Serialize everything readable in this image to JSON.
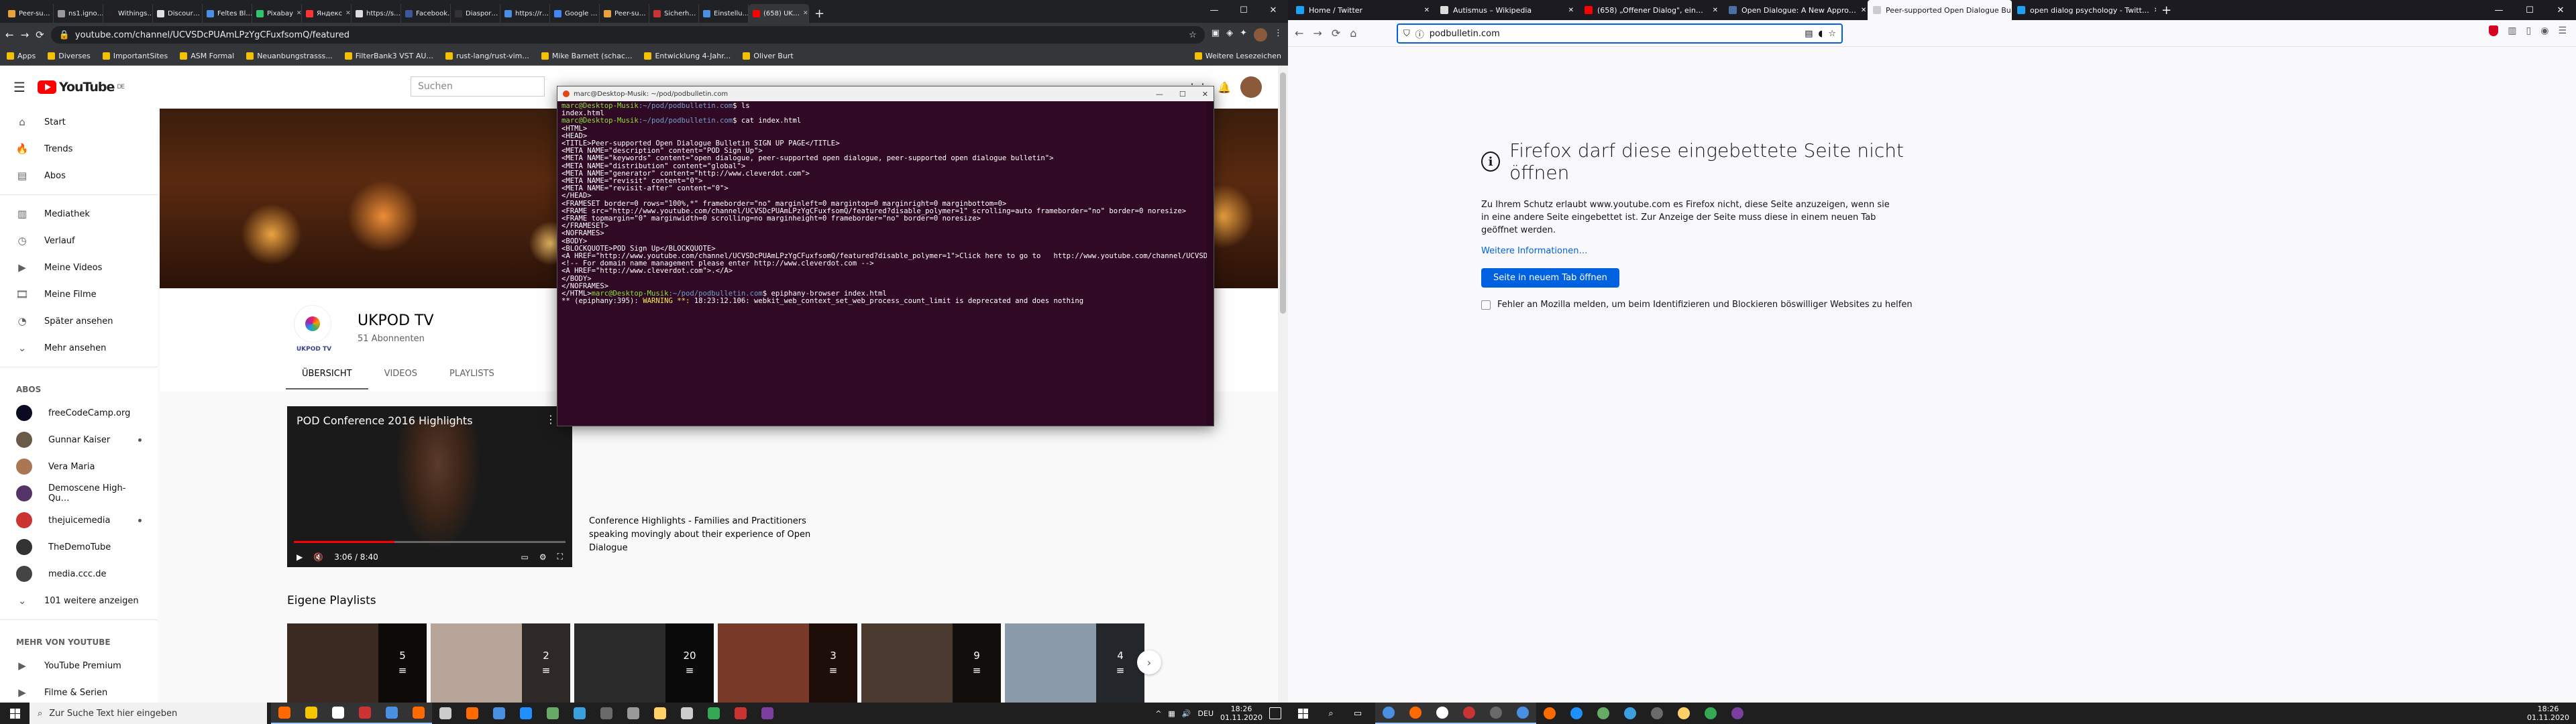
{
  "chrome": {
    "tabs": [
      {
        "label": "Peer-su…",
        "color": "#e9a23b"
      },
      {
        "label": "ns1.igno…",
        "color": "#999999"
      },
      {
        "label": "Withings…",
        "color": "#222222"
      },
      {
        "label": "Discour…",
        "color": "#e0e0e0"
      },
      {
        "label": "Feltes Bl…",
        "color": "#4a90e2"
      },
      {
        "label": "Pixabay",
        "color": "#2ec66d"
      },
      {
        "label": "Яндекс",
        "color": "#ff3333"
      },
      {
        "label": "https://s…",
        "color": "#dddddd"
      },
      {
        "label": "Facebook…",
        "color": "#3b5998"
      },
      {
        "label": "Diaspor…",
        "color": "#333333"
      },
      {
        "label": "https://r…",
        "color": "#4a90e2"
      },
      {
        "label": "Google …",
        "color": "#4285f4"
      },
      {
        "label": "Peer-su…",
        "color": "#e9a23b"
      },
      {
        "label": "Sicherh…",
        "color": "#cc3333"
      },
      {
        "label": "Einstellu…",
        "color": "#4a90e2"
      },
      {
        "label": "(658) UK…",
        "color": "#ff0000",
        "active": true
      }
    ],
    "url": "youtube.com/channel/UCVSDcPUAmLPzYgCFuxfsomQ/featured",
    "bookmarks": [
      "Apps",
      "Diverses",
      "ImportantSites",
      "ASM Formal",
      "Neuanbungstrasss...",
      "FilterBank3 VST AU...",
      "rust-lang/rust-vim...",
      "Mike Barnett (schac...",
      "Entwicklung 4-Jahr...",
      "Oliver Burt"
    ],
    "bookmarks_right": "Weitere Lesezeichen"
  },
  "youtube": {
    "logo_text": "YouTube",
    "logo_region": "DE",
    "search_placeholder": "Suchen",
    "sidebar_main": [
      {
        "label": "Start",
        "icon": "home-icon"
      },
      {
        "label": "Trends",
        "icon": "trending-icon"
      },
      {
        "label": "Abos",
        "icon": "subscriptions-icon"
      }
    ],
    "sidebar_lib": [
      {
        "label": "Mediathek",
        "icon": "library-icon"
      },
      {
        "label": "Verlauf",
        "icon": "history-icon"
      },
      {
        "label": "Meine Videos",
        "icon": "my-videos-icon"
      },
      {
        "label": "Meine Filme",
        "icon": "movies-icon"
      },
      {
        "label": "Später ansehen",
        "icon": "watch-later-icon"
      },
      {
        "label": "Mehr ansehen",
        "icon": "chevron-down-icon"
      }
    ],
    "abos_header": "ABOS",
    "abos": [
      {
        "label": "freeCodeCamp.org",
        "color": "#0a0a23",
        "live": false
      },
      {
        "label": "Gunnar Kaiser",
        "color": "#6a5a4a",
        "live": true
      },
      {
        "label": "Vera Maria",
        "color": "#aa7755",
        "live": false
      },
      {
        "label": "Demoscene High-Qu…",
        "color": "#553366",
        "live": false
      },
      {
        "label": "thejuicemedia",
        "color": "#cc3333",
        "live": true
      },
      {
        "label": "TheDemoTube",
        "color": "#333333",
        "live": false
      },
      {
        "label": "media.ccc.de",
        "color": "#444444",
        "live": false
      }
    ],
    "abos_more": "101 weitere anzeigen",
    "more_header": "MEHR VON YOUTUBE",
    "more_items": [
      "YouTube Premium",
      "Filme & Serien"
    ],
    "channel": {
      "name": "UKPOD TV",
      "subscribers": "51 Abonnenten",
      "logo_text": "UKPOD TV",
      "tabs": [
        "ÜBERSICHT",
        "VIDEOS",
        "PLAYLISTS"
      ]
    },
    "featured_video": {
      "title": "POD Conference 2016 Highlights",
      "time": "3:06 / 8:40",
      "progress": 0.37,
      "description": "Conference Highlights - Families and Practitioners speaking movingly about their experience of Open Dialogue"
    },
    "playlists_header": "Eigene Playlists",
    "playlists": [
      {
        "count": "5",
        "color": "#3a2a22"
      },
      {
        "count": "2",
        "color": "#b8a59a"
      },
      {
        "count": "20",
        "color": "#2a2a2a"
      },
      {
        "count": "3",
        "color": "#7a3a2a"
      },
      {
        "count": "9",
        "color": "#4a3a30"
      },
      {
        "count": "4",
        "color": "#8a9aaa"
      }
    ]
  },
  "terminal": {
    "title": "marc@Desktop-Musik: ~/pod/podbulletin.com",
    "prompt": "marc@Desktop-Musik",
    "dir": ":~/pod/podbulletin.com",
    "cmd1": "$ ls",
    "out1": "index.html",
    "cmd2": "$ cat index.html",
    "html_lines": [
      "<HTML>",
      "<HEAD>",
      "<TITLE>Peer-supported Open Dialogue Bulletin SIGN UP PAGE</TITLE>",
      "<META NAME=\"description\" content=\"POD Sign Up\">",
      "<META NAME=\"keywords\" content=\"open dialogue, peer-supported open dialogue, peer-supported open dialogue bulletin\">",
      "<META NAME=\"distribution\" content=\"global\">",
      "<META NAME=\"generator\" content=\"http://www.cleverdot.com\">",
      "<META NAME=\"revisit\" content=\"0\">",
      "<META NAME=\"revisit-after\" content=\"0\">",
      "</HEAD>",
      "<FRAMESET border=0 rows=\"100%,*\" frameborder=\"no\" marginleft=0 margintop=0 marginright=0 marginbottom=0>",
      "<FRAME src=\"http://www.youtube.com/channel/UCVSDcPUAmLPzYgCFuxfsomQ/featured?disable_polymer=1\" scrolling=auto frameborder=\"no\" border=0 noresize>",
      "<FRAME topmargin=\"0\" marginwidth=0 scrolling=no marginheight=0 frameborder=\"no\" border=0 noresize>",
      "</FRAMESET>",
      "<NOFRAMES>",
      "<BODY>",
      "<BLOCKQUOTE>POD Sign Up</BLOCKQUOTE>",
      "<A HREF=\"http://www.youtube.com/channel/UCVSDcPUAmLPzYgCFuxfsomQ/featured?disable_polymer=1\">Click here to go to   http://www.youtube.com/channel/UCVSDcPUAmLPzYgCFuxfsomQ/featured?disable_polymer=1</A><BR>",
      "<!-- For domain name management please enter http://www.cleverdot.com -->",
      "<A HREF=\"http://www.cleverdot.com\">.</A>",
      "</BODY>",
      "</NOFRAMES>"
    ],
    "last_prefix": "</HTML>",
    "cmd3": "$ epiphany-browser index.html",
    "warn_prefix": "** (epiphany:395): ",
    "warn_label": "WARNING **: ",
    "warn_text": "18:23:12.106: webkit_web_context_set_web_process_count_limit is deprecated and does nothing"
  },
  "firefox": {
    "tabs": [
      {
        "label": "Home / Twitter",
        "color": "#1da1f2"
      },
      {
        "label": "Autismus – Wikipedia",
        "color": "#dddddd"
      },
      {
        "label": "(658) „Offener Dialog\", ein…",
        "color": "#ff0000"
      },
      {
        "label": "Open Dialogue: A New Appro…",
        "color": "#4a6fa5"
      },
      {
        "label": "Peer-supported Open Dialogue Bu…",
        "color": "#cccccc",
        "active": true
      },
      {
        "label": "open dialog psychology - Twitt…",
        "color": "#1da1f2"
      }
    ],
    "url": "podbulletin.com",
    "error_title": "Firefox darf diese eingebettete Seite nicht öffnen",
    "error_message": "Zu Ihrem Schutz erlaubt www.youtube.com es Firefox nicht, diese Seite anzuzeigen, wenn sie in eine andere Seite eingebettet ist. Zur Anzeige der Seite muss diese in einem neuen Tab geöffnet werden.",
    "more_info": "Weitere Informationen…",
    "button": "Seite in neuem Tab öffnen",
    "checkbox_label": "Fehler an Mozilla melden, um beim Identifizieren und Blockieren böswilliger Websites zu helfen"
  },
  "taskbar_left": {
    "search_placeholder": "Zur Suche Text hier eingeben",
    "apps": [
      "#ff6a00",
      "#f5c400",
      "#ffffff",
      "#cc3333",
      "#4a90e2",
      "#ff6a00",
      "#cccccc",
      "#ff6a00",
      "#4a90e2",
      "#1e90ff",
      "#66aa66",
      "#3aa0e0",
      "#6a6a6a",
      "#999999",
      "#ffd166",
      "#cccccc",
      "#34a853",
      "#cc3333",
      "#7b3fa0"
    ],
    "lang": "DEU",
    "time": "18:26",
    "date": "01.11.2020"
  },
  "taskbar_right": {
    "apps": [
      "#4a90e2",
      "#ff6a00",
      "#ffffff",
      "#cc3333",
      "#6a6a6a",
      "#4a90e2",
      "#ff6a00",
      "#1e90ff",
      "#66aa66",
      "#3aa0e0",
      "#6a6a6a",
      "#ffd166",
      "#34a853",
      "#7b3fa0"
    ],
    "time": "18:26",
    "date": "01.11.2020"
  }
}
